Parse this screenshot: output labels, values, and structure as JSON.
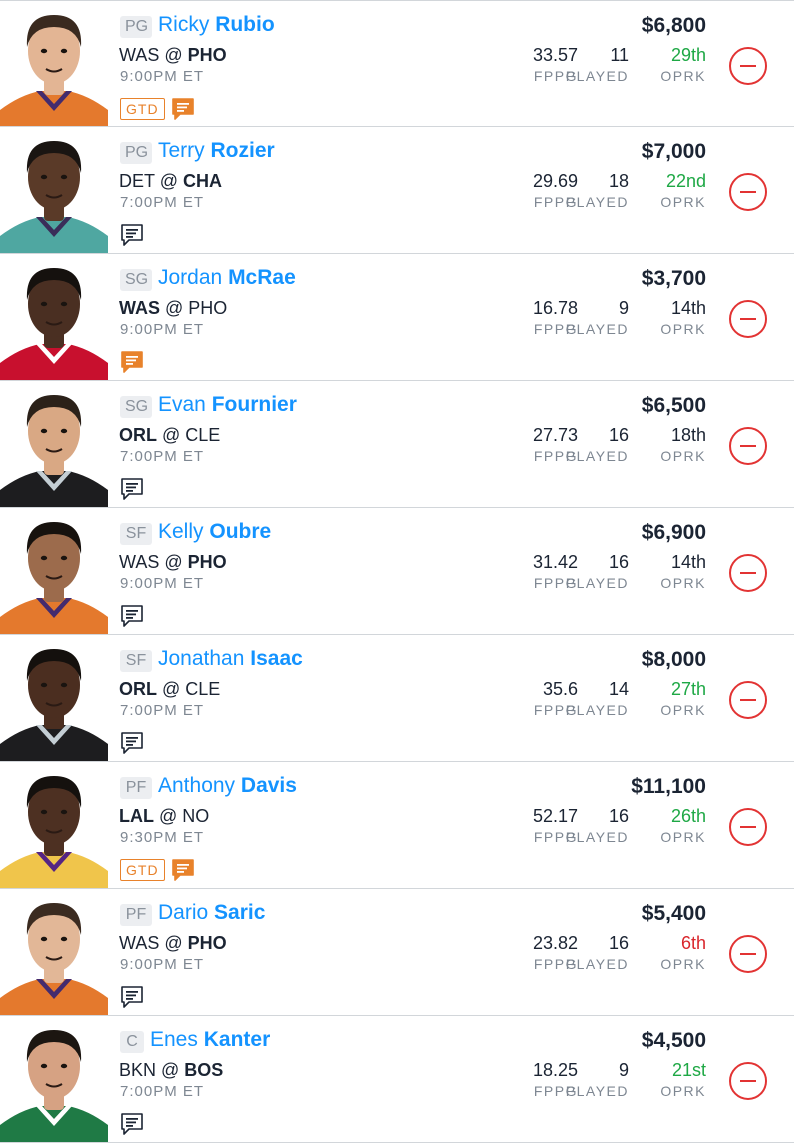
{
  "colors": {
    "link_blue": "#1493ff",
    "good_rank": "#1ea845",
    "bad_rank": "#d9262c",
    "remove_red": "#e23333",
    "gtd_orange": "#e8822b"
  },
  "labels": {
    "fppg": "FPPG",
    "played": "PLAYED",
    "oprk": "OPRK"
  },
  "players": [
    {
      "pos": "PG",
      "first": "Ricky",
      "last": "Rubio",
      "away": "WAS",
      "home": "PHO",
      "bold_team": "home",
      "time": "9:00PM ET",
      "salary": "$6,800",
      "fppg": "33.57",
      "played": "11",
      "oprk": "29th",
      "oprk_tone": "good",
      "gtd": "GTD",
      "note_highlight": true,
      "jersey": "#e4792d",
      "accent": "#432b6e",
      "skin": "#e3b594",
      "hair": "#3a2a1f"
    },
    {
      "pos": "PG",
      "first": "Terry",
      "last": "Rozier",
      "away": "DET",
      "home": "CHA",
      "bold_team": "home",
      "time": "7:00PM ET",
      "salary": "$7,000",
      "fppg": "29.69",
      "played": "18",
      "oprk": "22nd",
      "oprk_tone": "good",
      "gtd": "",
      "note_highlight": false,
      "jersey": "#4fa7a1",
      "accent": "#3a2d59",
      "skin": "#5a3a28",
      "hair": "#1a1512"
    },
    {
      "pos": "SG",
      "first": "Jordan",
      "last": "McRae",
      "away": "WAS",
      "home": "PHO",
      "bold_team": "away",
      "time": "9:00PM ET",
      "salary": "$3,700",
      "fppg": "16.78",
      "played": "9",
      "oprk": "14th",
      "oprk_tone": "neutral",
      "gtd": "",
      "note_highlight": true,
      "jersey": "#c8102e",
      "accent": "#ffffff",
      "skin": "#4a2f22",
      "hair": "#15110e"
    },
    {
      "pos": "SG",
      "first": "Evan",
      "last": "Fournier",
      "away": "ORL",
      "home": "CLE",
      "bold_team": "away",
      "time": "7:00PM ET",
      "salary": "$6,500",
      "fppg": "27.73",
      "played": "16",
      "oprk": "18th",
      "oprk_tone": "neutral",
      "gtd": "",
      "note_highlight": false,
      "jersey": "#1d1d1f",
      "accent": "#c4ced4",
      "skin": "#d9a884",
      "hair": "#2b2119"
    },
    {
      "pos": "SF",
      "first": "Kelly",
      "last": "Oubre",
      "away": "WAS",
      "home": "PHO",
      "bold_team": "home",
      "time": "9:00PM ET",
      "salary": "$6,900",
      "fppg": "31.42",
      "played": "16",
      "oprk": "14th",
      "oprk_tone": "neutral",
      "gtd": "",
      "note_highlight": false,
      "jersey": "#e4792d",
      "accent": "#432b6e",
      "skin": "#9c6b4c",
      "hair": "#17120e"
    },
    {
      "pos": "SF",
      "first": "Jonathan",
      "last": "Isaac",
      "away": "ORL",
      "home": "CLE",
      "bold_team": "away",
      "time": "7:00PM ET",
      "salary": "$8,000",
      "fppg": "35.6",
      "played": "14",
      "oprk": "27th",
      "oprk_tone": "good",
      "gtd": "",
      "note_highlight": false,
      "jersey": "#1d1d1f",
      "accent": "#c4ced4",
      "skin": "#4b2e20",
      "hair": "#14100d"
    },
    {
      "pos": "PF",
      "first": "Anthony",
      "last": "Davis",
      "away": "LAL",
      "home": "NO",
      "bold_team": "away",
      "time": "9:30PM ET",
      "salary": "$11,100",
      "fppg": "52.17",
      "played": "16",
      "oprk": "26th",
      "oprk_tone": "good",
      "gtd": "GTD",
      "note_highlight": true,
      "jersey": "#f0c54b",
      "accent": "#552583",
      "skin": "#4d3022",
      "hair": "#15110e"
    },
    {
      "pos": "PF",
      "first": "Dario",
      "last": "Saric",
      "away": "WAS",
      "home": "PHO",
      "bold_team": "home",
      "time": "9:00PM ET",
      "salary": "$5,400",
      "fppg": "23.82",
      "played": "16",
      "oprk": "6th",
      "oprk_tone": "bad",
      "gtd": "",
      "note_highlight": false,
      "jersey": "#e4792d",
      "accent": "#432b6e",
      "skin": "#e2b797",
      "hair": "#3b2b20"
    },
    {
      "pos": "C",
      "first": "Enes",
      "last": "Kanter",
      "away": "BKN",
      "home": "BOS",
      "bold_team": "home",
      "time": "7:00PM ET",
      "salary": "$4,500",
      "fppg": "18.25",
      "played": "9",
      "oprk": "21st",
      "oprk_tone": "good",
      "gtd": "",
      "note_highlight": false,
      "jersey": "#1f7a45",
      "accent": "#ffffff",
      "skin": "#d6a283",
      "hair": "#1c1611"
    }
  ]
}
